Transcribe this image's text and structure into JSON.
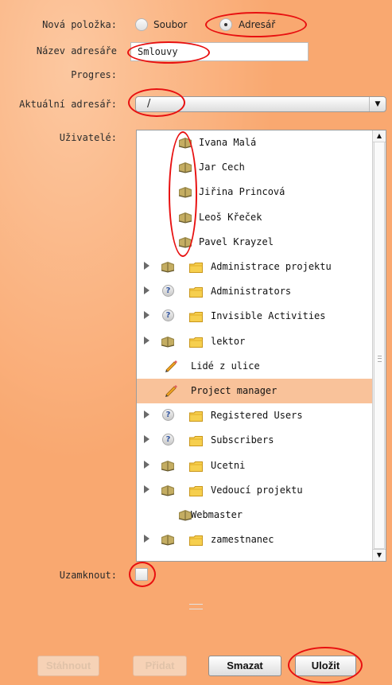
{
  "form": {
    "new_item_label": "Nová položka:",
    "radio_file_label": "Soubor",
    "radio_dir_label": "Adresář",
    "selected_type": "Adresář",
    "dir_name_label": "Název adresáře",
    "dir_name_value": "Smlouvy",
    "progress_label": "Progres:",
    "current_dir_label": "Aktuální adresář:",
    "current_dir_value": "/",
    "users_label": "Uživatelé:",
    "lock_label": "Uzamknout:",
    "lock_checked": false
  },
  "users_tree": [
    {
      "label": "Ivana Malá",
      "icon": "book-icon",
      "expandable": false,
      "folder": false,
      "selected": false
    },
    {
      "label": "Jar Cech",
      "icon": "book-icon",
      "expandable": false,
      "folder": false,
      "selected": false
    },
    {
      "label": "Jiřina Princová",
      "icon": "book-icon",
      "expandable": false,
      "folder": false,
      "selected": false
    },
    {
      "label": "Leoš Křeček",
      "icon": "book-icon",
      "expandable": false,
      "folder": false,
      "selected": false
    },
    {
      "label": "Pavel Krayzel",
      "icon": "book-icon",
      "expandable": false,
      "folder": false,
      "selected": false
    },
    {
      "label": "Administrace projektu",
      "icon": "book-icon",
      "expandable": true,
      "folder": true,
      "selected": false
    },
    {
      "label": "Administrators",
      "icon": "question-icon",
      "expandable": true,
      "folder": true,
      "selected": false
    },
    {
      "label": "Invisible Activities",
      "icon": "question-icon",
      "expandable": true,
      "folder": true,
      "selected": false
    },
    {
      "label": "lektor",
      "icon": "book-icon",
      "expandable": true,
      "folder": true,
      "selected": false
    },
    {
      "label": "Lidé z ulice",
      "icon": "pencil-icon",
      "expandable": false,
      "folder": false,
      "selected": false
    },
    {
      "label": "Project manager",
      "icon": "pencil-icon",
      "expandable": false,
      "folder": false,
      "selected": true
    },
    {
      "label": "Registered Users",
      "icon": "question-icon",
      "expandable": true,
      "folder": true,
      "selected": false
    },
    {
      "label": "Subscribers",
      "icon": "question-icon",
      "expandable": true,
      "folder": true,
      "selected": false
    },
    {
      "label": "Ucetni",
      "icon": "book-icon",
      "expandable": true,
      "folder": true,
      "selected": false
    },
    {
      "label": "Vedoucí projektu",
      "icon": "book-icon",
      "expandable": true,
      "folder": true,
      "selected": false
    },
    {
      "label": "Webmaster",
      "icon": "book-icon",
      "expandable": false,
      "folder": false,
      "selected": false
    },
    {
      "label": "zamestnanec",
      "icon": "book-icon",
      "expandable": true,
      "folder": true,
      "selected": false
    }
  ],
  "buttons": {
    "download": "Stáhnout",
    "add": "Přidat",
    "delete": "Smazat",
    "save": "Uložit"
  },
  "colors": {
    "background": "#f9a870",
    "selected_row": "#f9c29a",
    "annotation": "#e81010"
  }
}
